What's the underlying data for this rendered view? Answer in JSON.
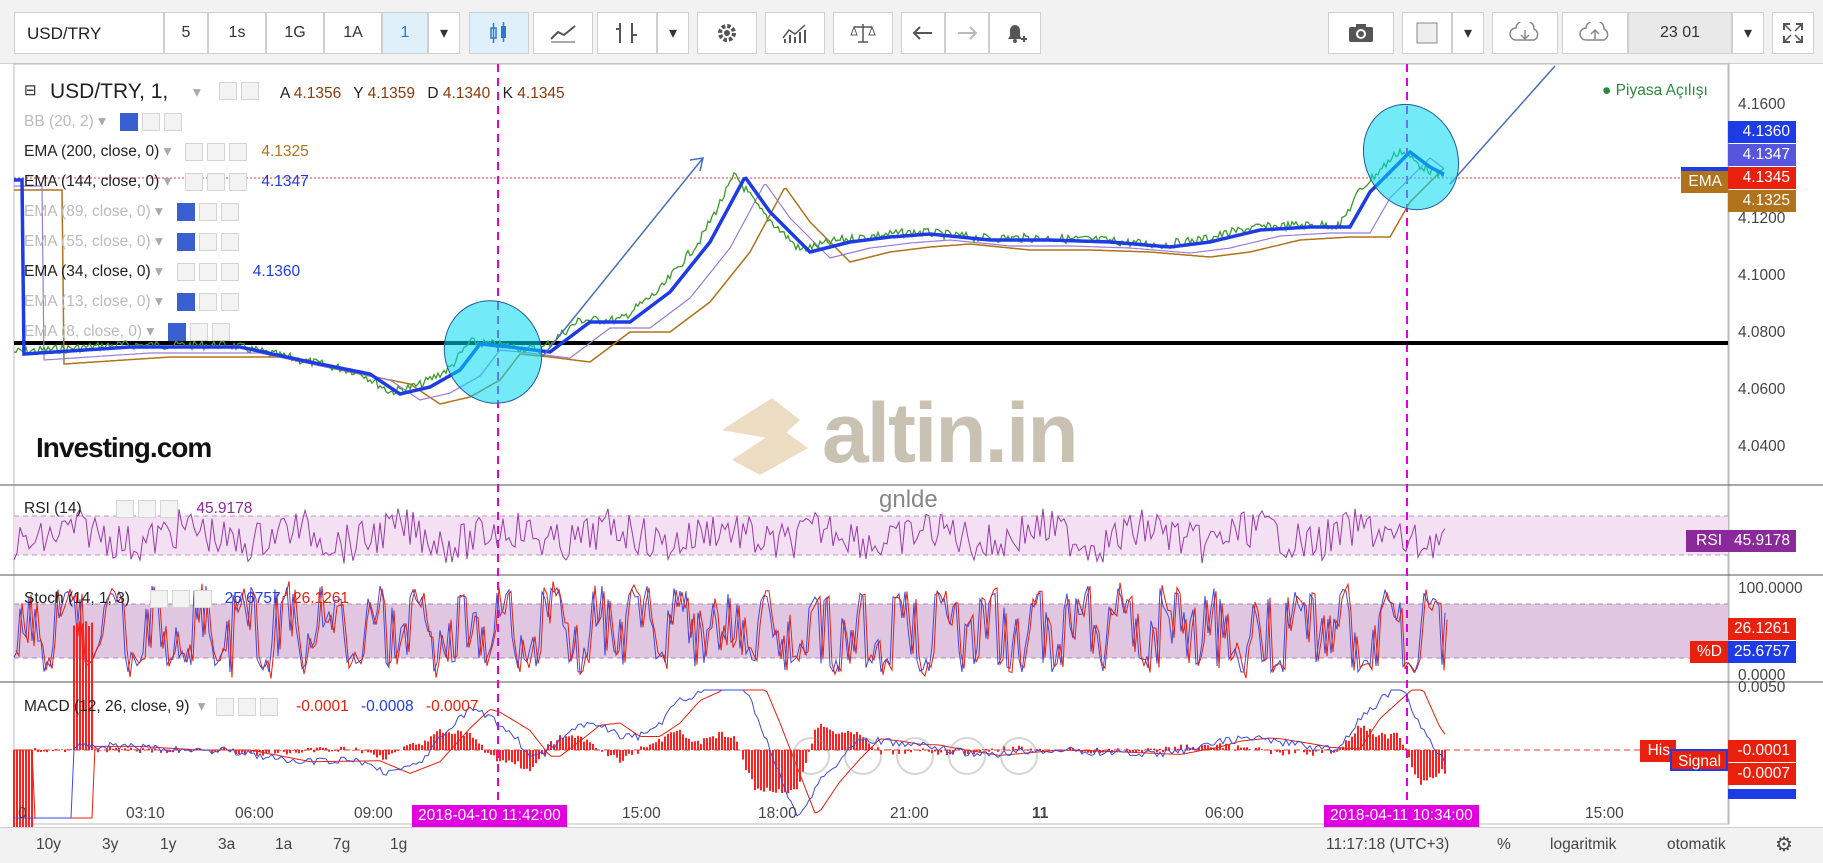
{
  "toolbar": {
    "symbol": "USD/TRY",
    "intervals": [
      "5",
      "1s",
      "1G",
      "1A",
      "1"
    ],
    "active_interval": "1",
    "date_box": "23 01",
    "colors": {
      "active_bg": "#dff0fb",
      "active_text": "#2a7bd0"
    }
  },
  "main_pane": {
    "title": "USD/TRY, 1,",
    "ohlc": [
      {
        "label": "A",
        "value": "4.1356"
      },
      {
        "label": "Y",
        "value": "4.1359"
      },
      {
        "label": "D",
        "value": "4.1340"
      },
      {
        "label": "K",
        "value": "4.1345"
      }
    ],
    "market_status": "● Piyasa Açılışı",
    "indicators": [
      {
        "label": "BB (20, 2)",
        "value": "",
        "visible": false
      },
      {
        "label": "EMA (200, close, 0)",
        "value": "4.1325",
        "visible": true
      },
      {
        "label": "EMA (144, close, 0)",
        "value": "4.1347",
        "visible": true
      },
      {
        "label": "EMA (89, close, 0)",
        "value": "",
        "visible": false
      },
      {
        "label": "EMA (55, close, 0)",
        "value": "",
        "visible": false
      },
      {
        "label": "EMA (34, close, 0)",
        "value": "4.1360",
        "visible": true
      },
      {
        "label": "EMA (13, close, 0)",
        "value": "",
        "visible": false
      },
      {
        "label": "EMA (8, close, 0)",
        "value": "",
        "visible": false
      }
    ],
    "price_axis": [
      "4.1600",
      "4.1200",
      "4.1000",
      "4.0800",
      "4.0600",
      "4.0400"
    ],
    "price_tags": {
      "ema34": "4.1360",
      "ema144": "4.1347",
      "ema_label": "EMA",
      "last": "4.1345",
      "ema200": "4.1325"
    },
    "watermark": "altin.in",
    "watermark_sub": "gnlde",
    "logo": "Investing.com",
    "colors": {
      "ema34": "#1e3ce6",
      "ema144": "#5555dd",
      "ema200": "#b0721a",
      "last": "#e8200c",
      "ellipse": "#00d8f0"
    }
  },
  "rsi_pane": {
    "label": "RSI (14)",
    "value": "45.9178",
    "tag_label": "RSI",
    "color": "#8a2a9a"
  },
  "stoch_pane": {
    "label": "Stoch (14, 1, 3)",
    "k_value": "25.6757",
    "d_value": "26.1261",
    "axis": [
      "100.0000",
      "0.0000"
    ],
    "tag_d": "%D",
    "tag_d_value": "26.1261",
    "tag_k_value": "25.6757"
  },
  "macd_pane": {
    "label": "MACD (12, 26, close, 9)",
    "values": [
      "-0.0001",
      "-0.0008",
      "-0.0007"
    ],
    "axis_top": "0.0050",
    "tag_hist": "His",
    "tag_signal": "Signal",
    "tag_values": [
      "-0.0001",
      "-0.0007"
    ]
  },
  "time_axis": {
    "labels": [
      "0",
      "03:10",
      "06:00",
      "09:00",
      "15:00",
      "18:00",
      "21:00",
      "11",
      "06:00",
      "15:00"
    ],
    "highlight_1": "2018-04-10 11:42:00",
    "highlight_2": "2018-04-11 10:34:00"
  },
  "bottom_bar": {
    "ranges": [
      "10y",
      "3y",
      "1y",
      "3a",
      "1a",
      "7g",
      "1g"
    ],
    "clock": "11:17:18 (UTC+3)",
    "percent": "%",
    "log": "logaritmik",
    "auto": "otomatik"
  }
}
